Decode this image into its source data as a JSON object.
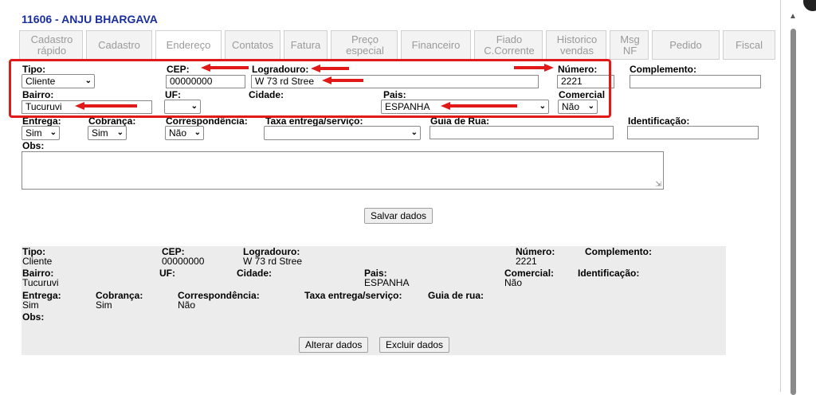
{
  "header": {
    "title": "11606 - ANJU BHARGAVA"
  },
  "tabs": [
    {
      "label": "Cadastro rápido"
    },
    {
      "label": "Cadastro"
    },
    {
      "label": "Endereço"
    },
    {
      "label": "Contatos"
    },
    {
      "label": "Fatura"
    },
    {
      "label": "Preço especial"
    },
    {
      "label": "Financeiro"
    },
    {
      "label": "Fiado C.Corrente"
    },
    {
      "label": "Historico vendas"
    },
    {
      "label": "Msg NF"
    },
    {
      "label": "Pedido"
    },
    {
      "label": "Fiscal"
    }
  ],
  "form": {
    "tipo_label": "Tipo:",
    "tipo_value": "Cliente",
    "cep_label": "CEP:",
    "cep_value": "00000000",
    "logradouro_label": "Logradouro:",
    "logradouro_value": "W 73 rd Stree",
    "numero_label": "Número:",
    "numero_value": "2221",
    "complemento_label": "Complemento:",
    "complemento_value": "",
    "bairro_label": "Bairro:",
    "bairro_value": "Tucuruvi",
    "uf_label": "UF:",
    "uf_value": "",
    "cidade_label": "Cidade:",
    "pais_label": "Pais:",
    "pais_value": "ESPANHA",
    "comercial_label": "Comercial",
    "comercial_value": "Não",
    "entrega_label": "Entrega:",
    "entrega_value": "Sim",
    "cobranca_label": "Cobrança:",
    "cobranca_value": "Sim",
    "correspondencia_label": "Correspondência:",
    "correspondencia_value": "Não",
    "taxa_label": "Taxa entrega/serviço:",
    "taxa_value": "",
    "guia_label": "Guia de Rua:",
    "guia_value": "",
    "identificacao_label": "Identificação:",
    "identificacao_value": "",
    "obs_label": "Obs:",
    "save_button": "Salvar dados"
  },
  "summary": {
    "tipo_label": "Tipo:",
    "tipo_value": "Cliente",
    "cep_label": "CEP:",
    "cep_value": "00000000",
    "logradouro_label": "Logradouro:",
    "logradouro_value": "W 73 rd Stree",
    "numero_label": "Número:",
    "numero_value": "2221",
    "complemento_label": "Complemento:",
    "bairro_label": "Bairro:",
    "bairro_value": "Tucuruvi",
    "uf_label": "UF:",
    "cidade_label": "Cidade:",
    "pais_label": "Pais:",
    "pais_value": "ESPANHA",
    "comercial_label": "Comercial:",
    "comercial_value": "Não",
    "identificacao_label": "Identificação:",
    "entrega_label": "Entrega:",
    "entrega_value": "Sim",
    "cobranca_label": "Cobrança:",
    "cobranca_value": "Sim",
    "correspondencia_label": "Correspondência:",
    "correspondencia_value": "Não",
    "taxa_label": "Taxa entrega/serviço:",
    "guia_label": "Guia de rua:",
    "obs_label": "Obs:",
    "alter_button": "Alterar dados",
    "delete_button": "Excluir dados"
  },
  "colors": {
    "title": "#1a2e9e",
    "annotation": "#e11919",
    "panel": "#ececec"
  }
}
